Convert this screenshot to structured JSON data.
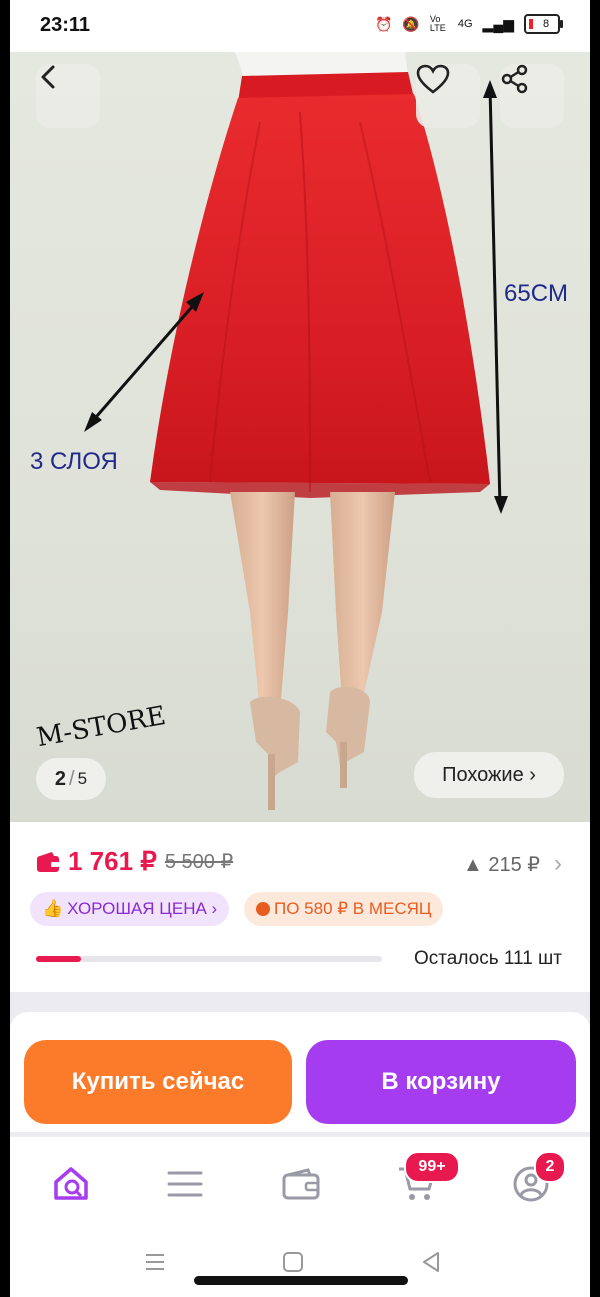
{
  "status_bar": {
    "time": "23:11",
    "network": "4G",
    "volte": "Vo LTE",
    "battery": "8"
  },
  "gallery": {
    "page_current": "2",
    "page_separator": "/",
    "page_total": "5",
    "similar_label": "Похожие ›",
    "annotation_length": "65CM",
    "annotation_layers": "3 СЛОЯ",
    "watermark": "M-STORE"
  },
  "product": {
    "price": "1 761 ₽",
    "old_price": "5 500 ₽",
    "price_drop": "▲ 215 ₽",
    "badge_good_price": "ХОРОШАЯ ЦЕНА ›",
    "badge_installment": "ПО 580 ₽ В МЕСЯЦ",
    "stock_text": "Осталось 111 шт",
    "stock_fraction": 0.13
  },
  "actions": {
    "buy_now": "Купить сейчас",
    "add_to_cart": "В корзину"
  },
  "tabbar": {
    "cart_badge": "99+",
    "profile_badge": "2"
  },
  "colors": {
    "accent": "#e8194f",
    "buy": "#fb7b2b",
    "cart": "#a53cf0",
    "annotation": "#1f2a8a"
  },
  "icons": [
    "back-icon",
    "heart-icon",
    "share-icon",
    "wallet-icon",
    "thumb-up-icon",
    "installment-icon",
    "search-home-icon",
    "menu-icon",
    "wallet-tab-icon",
    "cart-icon",
    "profile-icon"
  ]
}
